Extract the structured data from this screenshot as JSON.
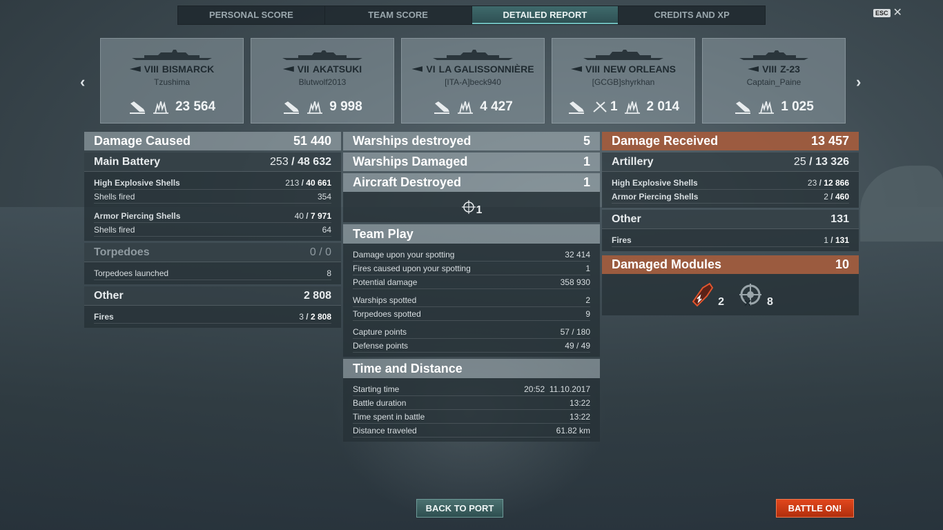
{
  "tabs": [
    {
      "label": "PERSONAL SCORE"
    },
    {
      "label": "TEAM SCORE"
    },
    {
      "label": "DETAILED REPORT"
    },
    {
      "label": "CREDITS AND XP"
    }
  ],
  "esc_label": "ESC",
  "ships": [
    {
      "tier": "VIII",
      "name": "BISMARCK",
      "player": "Tzushima",
      "planes": "",
      "damage": "23 564"
    },
    {
      "tier": "VII",
      "name": "AKATSUKI",
      "player": "Blutwolf2013",
      "planes": "",
      "damage": "9 998"
    },
    {
      "tier": "VI",
      "name": "LA GALISSONNIÈRE",
      "player": "[ITA-A]beck940",
      "planes": "",
      "damage": "4 427"
    },
    {
      "tier": "VIII",
      "name": "NEW ORLEANS",
      "player": "[GCGB]shyrkhan",
      "planes": "1",
      "damage": "2 014"
    },
    {
      "tier": "VIII",
      "name": "Z-23",
      "player": "Captain_Paine",
      "planes": "",
      "damage": "1 025"
    }
  ],
  "damage_caused": {
    "title": "Damage Caused",
    "total": "51 440",
    "main_battery": {
      "label": "Main Battery",
      "hits": "253",
      "value": "48 632"
    },
    "he": {
      "label": "High Explosive Shells",
      "hits": "213",
      "value": "40 661",
      "fired_label": "Shells fired",
      "fired": "354"
    },
    "ap": {
      "label": "Armor Piercing Shells",
      "hits": "40",
      "value": "7 971",
      "fired_label": "Shells fired",
      "fired": "64"
    },
    "torpedoes": {
      "label": "Torpedoes",
      "value": "0 / 0",
      "launched_label": "Torpedoes launched",
      "launched": "8"
    },
    "other": {
      "label": "Other",
      "value": "2 808",
      "fires_label": "Fires",
      "fires_hits": "3",
      "fires_value": "2 808"
    }
  },
  "middle": {
    "destroyed_label": "Warships destroyed",
    "destroyed": "5",
    "damaged_label": "Warships Damaged",
    "damaged": "1",
    "aircraft_label": "Aircraft Destroyed",
    "aircraft": "1",
    "target_count": "1",
    "team_play": {
      "title": "Team Play",
      "rows": [
        {
          "label": "Damage upon your spotting",
          "value": "32 414"
        },
        {
          "label": "Fires caused upon your spotting",
          "value": "1"
        },
        {
          "label": "Potential damage",
          "value": "358 930"
        },
        {
          "label": "Warships spotted",
          "value": "2"
        },
        {
          "label": "Torpedoes spotted",
          "value": "9"
        },
        {
          "label": "Capture points",
          "value": "57 / 180"
        },
        {
          "label": "Defense points",
          "value": "49 / 49"
        }
      ]
    },
    "time": {
      "title": "Time and Distance",
      "rows": [
        {
          "label": "Starting time",
          "value": "20:52  11.10.2017"
        },
        {
          "label": "Battle duration",
          "value": "13:22"
        },
        {
          "label": "Time spent in battle",
          "value": "13:22"
        },
        {
          "label": "Distance traveled",
          "value": "61.82 km"
        }
      ]
    }
  },
  "damage_received": {
    "title": "Damage Received",
    "total": "13 457",
    "artillery": {
      "label": "Artillery",
      "hits": "25",
      "value": "13 326"
    },
    "he": {
      "label": "High Explosive Shells",
      "hits": "23",
      "value": "12 866"
    },
    "ap": {
      "label": "Armor Piercing Shells",
      "hits": "2",
      "value": "460"
    },
    "other": {
      "label": "Other",
      "value": "131",
      "fires_label": "Fires",
      "fires_hits": "1",
      "fires_value": "131"
    },
    "modules": {
      "label": "Damaged Modules",
      "value": "10",
      "engine": "2",
      "steering": "8"
    }
  },
  "buttons": {
    "back": "BACK TO PORT",
    "battle": "BATTLE ON!"
  },
  "colors": {
    "accent_orange": "#a05c3e",
    "battle_red": "#d03c14",
    "tab_active": "#3f6a6c"
  }
}
